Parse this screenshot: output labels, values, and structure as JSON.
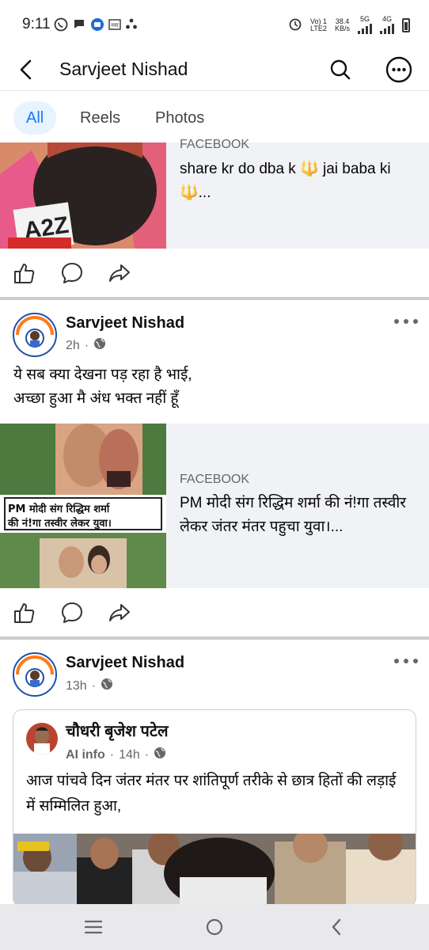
{
  "status": {
    "time": "9:11",
    "volte": "Vo) 1",
    "lte": "LTE2",
    "speed": "38.4",
    "speed_unit": "KB/s",
    "net1": "5G",
    "net2": "4G"
  },
  "header": {
    "title": "Sarvjeet Nishad"
  },
  "tabs": [
    {
      "label": "All",
      "active": true
    },
    {
      "label": "Reels",
      "active": false
    },
    {
      "label": "Photos",
      "active": false
    }
  ],
  "post0": {
    "link_source": "FACEBOOK",
    "link_title": "share kr do dba k 🔱 jai baba ki 🔱...",
    "thumb_text": "A2Z"
  },
  "post1": {
    "author": "Sarvjeet Nishad",
    "time": "2h",
    "text_line1": "ये सब क्या देखना पड़ रहा है भाई,",
    "text_line2": "अच्छा हुआ मै अंध भक्त नहीं हूँ",
    "link_source": "FACEBOOK",
    "link_title": "PM मोदी संग रिद्धिम शर्मा की नं!गा तस्वीर लेकर जंतर मंतर पहुचा युवा।...",
    "thumb_caption_line1": "PM मोदी संग रिद्धिम शर्मा",
    "thumb_caption_line2": "की नं!गा तस्वीर लेकर युवा।"
  },
  "post2": {
    "author": "Sarvjeet Nishad",
    "time": "13h",
    "shared_author": "चौधरी बृजेश पटेल",
    "shared_meta": "AI info",
    "shared_time": "14h",
    "shared_text": "आज पांचवे दिन जंतर मंतर पर शांतिपूर्ण तरीके से छात्र हितों की लड़ाई में सम्मिलित हुआ,"
  },
  "colors": {
    "accent": "#1877f2",
    "tab_active_bg": "#e7f3ff",
    "separator": "#c9ccd1",
    "meta": "#65676b"
  },
  "icons": [
    "whatsapp-icon",
    "chat-icon",
    "wallet-icon",
    "app-icon",
    "alarm-icon",
    "back-icon",
    "search-icon",
    "more-icon",
    "like-icon",
    "comment-icon",
    "share-icon",
    "globe-icon",
    "menu-icon",
    "home-icon",
    "nav-back-icon"
  ]
}
